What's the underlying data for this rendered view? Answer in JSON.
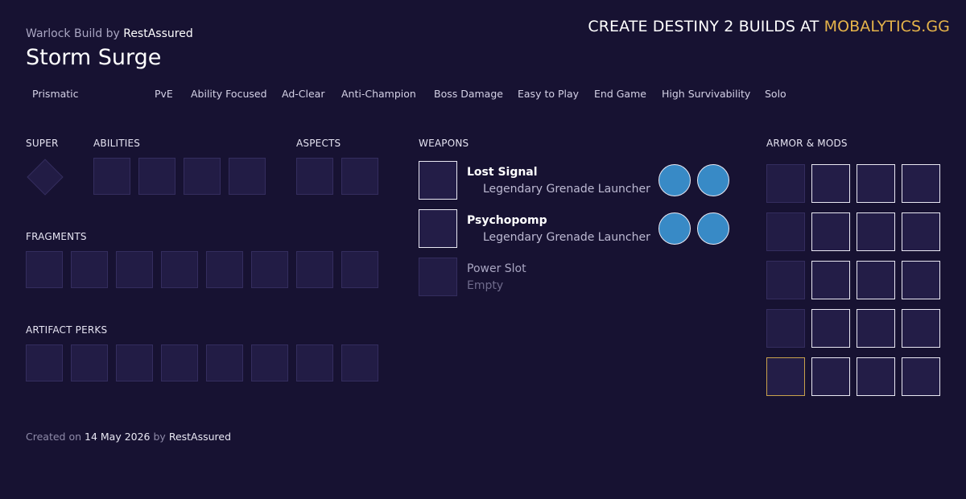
{
  "header": {
    "build_class_label": "Warlock Build by",
    "author": "RestAssured",
    "title": "Storm Surge",
    "promo_prefix": "CREATE DESTINY 2 BUILDS AT",
    "promo_brand": "MOBALYTICS.GG"
  },
  "tags": [
    "Prismatic",
    "PvE",
    "Ability Focused",
    "Ad-Clear",
    "Anti-Champion",
    "Boss Damage",
    "Easy to Play",
    "End Game",
    "High Survivability",
    "Solo"
  ],
  "sections": {
    "super": "SUPER",
    "abilities": "ABILITIES",
    "aspects": "ASPECTS",
    "fragments": "FRAGMENTS",
    "artifact_perks": "ARTIFACT PERKS",
    "weapons": "WEAPONS",
    "armor_mods": "ARMOR & MODS"
  },
  "weapons": [
    {
      "name": "Lost Signal",
      "type": "Legendary Grenade Launcher"
    },
    {
      "name": "Psychopomp",
      "type": "Legendary Grenade Launcher"
    },
    {
      "name": "Power Slot",
      "type": "Empty"
    }
  ],
  "footer": {
    "created_label": "Created on",
    "date": "14 May 2026",
    "by_label": "by",
    "author": "RestAssured"
  },
  "colors": {
    "background": "#171232",
    "brand": "#e6b44a",
    "perk": "#388ac6",
    "exotic_border": "#c9a24c"
  }
}
